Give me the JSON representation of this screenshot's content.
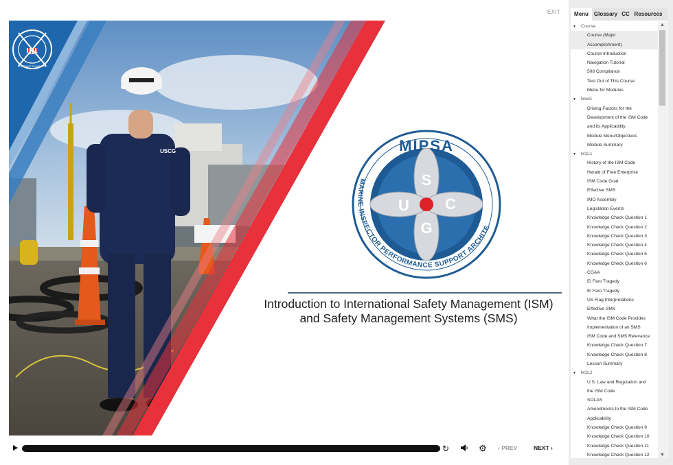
{
  "player": {
    "exit_label": "EXIT"
  },
  "slide": {
    "badge_text": "U.S. COAST GUARD 1790",
    "hat_text": "USCG",
    "logo": {
      "word": "MIPSA",
      "ring_text": "MARINE INSPECTOR PERFORMANCE SUPPORT ARCHITECTURE",
      "letters": [
        "S",
        "C",
        "G",
        "U"
      ]
    },
    "title_line1": "Introduction to International Safety Management (ISM)",
    "title_line2": "and Safety Management Systems (SMS)"
  },
  "controls": {
    "prev_label": "PREV",
    "next_label": "NEXT",
    "play_icon": "play-icon",
    "replay_icon": "replay-icon",
    "volume_icon": "volume-icon",
    "settings_icon": "gear-icon"
  },
  "sidebar": {
    "tabs": [
      "Menu",
      "Glossary",
      "CC",
      "Resources"
    ],
    "menu": [
      {
        "type": "section",
        "label": "Course"
      },
      {
        "type": "item",
        "label": "Course (Major"
      },
      {
        "type": "item",
        "label": "Accomplishment)"
      },
      {
        "type": "item",
        "label": "Course Introduction"
      },
      {
        "type": "item",
        "label": "Navigation Tutorial"
      },
      {
        "type": "item",
        "label": "508 Compliance"
      },
      {
        "type": "item",
        "label": "Test Out of This Course"
      },
      {
        "type": "item",
        "label": "Menu for Modules"
      },
      {
        "type": "section",
        "label": "Mod1"
      },
      {
        "type": "item",
        "label": "Driving Factors for the"
      },
      {
        "type": "item",
        "label": "Development of the ISM Code"
      },
      {
        "type": "item",
        "label": "and its Applicability"
      },
      {
        "type": "item",
        "label": "Module Menu/Objectives"
      },
      {
        "type": "item",
        "label": "Module Summary"
      },
      {
        "type": "section",
        "label": "M1L1"
      },
      {
        "type": "item",
        "label": "History of the ISM Code"
      },
      {
        "type": "item",
        "label": "Herald of Free Enterprise"
      },
      {
        "type": "item",
        "label": "ISM Code Goal"
      },
      {
        "type": "item",
        "label": "Effective SMS"
      },
      {
        "type": "item",
        "label": "IMO Assembly"
      },
      {
        "type": "item",
        "label": "Legislation Events"
      },
      {
        "type": "item",
        "label": "Knowledge Check Question 1"
      },
      {
        "type": "item",
        "label": "Knowledge Check Question 2"
      },
      {
        "type": "item",
        "label": "Knowledge Check Question 3"
      },
      {
        "type": "item",
        "label": "Knowledge Check Question 4"
      },
      {
        "type": "item",
        "label": "Knowledge Check Question 5"
      },
      {
        "type": "item",
        "label": "Knowledge Check Question 6"
      },
      {
        "type": "item",
        "label": "CGAA"
      },
      {
        "type": "item",
        "label": "El Faro Tragedy"
      },
      {
        "type": "item",
        "label": "El Faro Tragedy"
      },
      {
        "type": "item",
        "label": "US Flag Interpretations"
      },
      {
        "type": "item",
        "label": "Effective SMS"
      },
      {
        "type": "item",
        "label": "What the ISM Code Provides"
      },
      {
        "type": "item",
        "label": "Implementation of an SMS"
      },
      {
        "type": "item",
        "label": "ISM Code and SMS Relevance"
      },
      {
        "type": "item",
        "label": "Knowledge Check Question 7"
      },
      {
        "type": "item",
        "label": "Knowledge Check Question 8"
      },
      {
        "type": "item",
        "label": "Lesson Summary"
      },
      {
        "type": "section",
        "label": "M1L2"
      },
      {
        "type": "item",
        "label": "U.S. Law and Regulation and"
      },
      {
        "type": "item",
        "label": "the ISM Code"
      },
      {
        "type": "item",
        "label": "SOLAS"
      },
      {
        "type": "item",
        "label": "Amendments to the ISM Code"
      },
      {
        "type": "item",
        "label": "Applicability"
      },
      {
        "type": "item",
        "label": "Knowledge Check Question 9"
      },
      {
        "type": "item",
        "label": "Knowledge Check Question 10"
      },
      {
        "type": "item",
        "label": "Knowledge Check Question 11"
      },
      {
        "type": "item",
        "label": "Knowledge Check Question 12"
      }
    ]
  },
  "colors": {
    "uscg_blue": "#1f67ad",
    "uscg_red": "#e8313a",
    "navy": "#1c2b55",
    "logo_blue": "#1e5b94"
  }
}
